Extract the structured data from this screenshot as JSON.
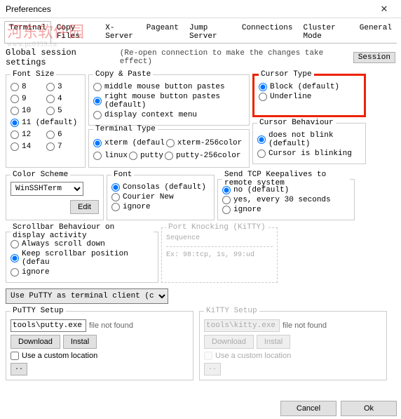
{
  "window": {
    "title": "Preferences",
    "close": "✕"
  },
  "watermark": {
    "main": "河东软件园",
    "sub": "www.pc0359.cn"
  },
  "tabs": {
    "items": [
      "Terminal",
      "Copy Files",
      "X-Server",
      "Pageant",
      "Jump Server",
      "Connections",
      "Cluster Mode",
      "General"
    ],
    "active_index": 0
  },
  "gss": {
    "title": "Global session settings",
    "note": "(Re-open connection to make the changes take effect)",
    "session_btn": "Session"
  },
  "fontsize": {
    "legend": "Font Size",
    "options": [
      "8",
      "3",
      "9",
      "4",
      "10",
      "5",
      "11 (default)",
      "12",
      "6",
      "14",
      "7"
    ],
    "selected": "11 (default)"
  },
  "copypaste": {
    "legend": "Copy & Paste",
    "options": [
      "middle mouse button pastes",
      "right mouse button pastes (default)",
      "display context menu"
    ],
    "selected": "right mouse button pastes (default)"
  },
  "cursortype": {
    "legend": "Cursor Type",
    "options": [
      "Block (default)",
      "Underline"
    ],
    "selected": "Block (default)"
  },
  "terminaltype": {
    "legend": "Terminal Type",
    "row1": [
      "xterm (defaul",
      "xterm-256color"
    ],
    "row2": [
      "linux",
      "putty",
      "putty-256color"
    ],
    "selected": "xterm (defaul"
  },
  "cursorbeh": {
    "legend": "Cursor Behaviour",
    "options": [
      "does not blink (default)",
      "Cursor is blinking"
    ],
    "selected": "does not blink (default)"
  },
  "colorscheme": {
    "legend": "Color Scheme",
    "value": "WinSSHTerm",
    "edit": "Edit"
  },
  "font": {
    "legend": "Font",
    "options": [
      "Consolas (default)",
      "Courier New",
      "ignore"
    ],
    "selected": "Consolas (default)"
  },
  "keepalive": {
    "legend": "Send TCP Keepalives to remote system",
    "options": [
      "no (default)",
      "yes, every 30 seconds",
      "ignore"
    ],
    "selected": "no (default)"
  },
  "scrollbar": {
    "legend": "Scrollbar Behaviour on display activity",
    "options": [
      "Always scroll down",
      "Keep scrollbar position (defau",
      "ignore"
    ],
    "selected": "Keep scrollbar position (defau"
  },
  "portknock": {
    "legend": "Port Knocking (KiTTY)",
    "sub": "Sequence",
    "placeholder": "Ex: 98:tcp, 1s, 99:ud"
  },
  "client_combo": "Use PuTTY as terminal client (c",
  "putty": {
    "legend": "PuTTY Setup",
    "path": "tools\\putty.exe",
    "notfound": "file not found",
    "download": "Download",
    "install": "Instal",
    "custom": "Use a custom location",
    "browse": ".."
  },
  "kitty": {
    "legend": "KiTTY Setup",
    "path": "tools\\kitty.exe",
    "notfound": "file not found",
    "download": "Download",
    "install": "Instal",
    "custom": "Use a custom location",
    "browse": ".."
  },
  "footer": {
    "cancel": "Cancel",
    "ok": "Ok"
  }
}
